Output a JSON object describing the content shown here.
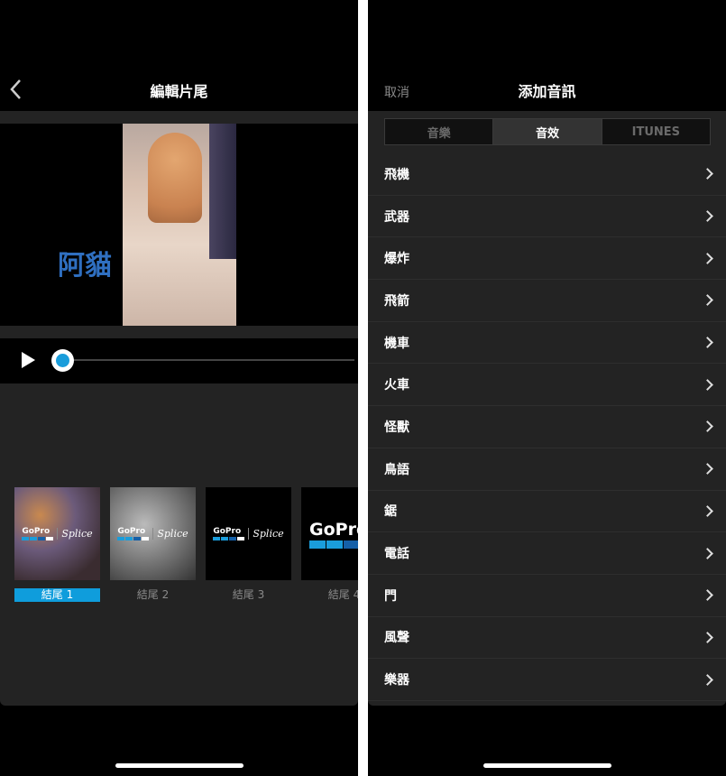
{
  "left": {
    "title": "編輯片尾",
    "video_caption": "阿貓",
    "playback_progress": 0,
    "endings": [
      {
        "label": "結尾 1",
        "selected": true,
        "style": "color-blur"
      },
      {
        "label": "結尾 2",
        "selected": false,
        "style": "gray-blur"
      },
      {
        "label": "結尾 3",
        "selected": false,
        "style": "black"
      },
      {
        "label": "結尾 4",
        "selected": false,
        "style": "black-large"
      }
    ],
    "logo": {
      "brand": "GoPro",
      "product": "Splice"
    }
  },
  "right": {
    "cancel": "取消",
    "title": "添加音訊",
    "tabs": [
      {
        "label": "音樂",
        "active": false
      },
      {
        "label": "音效",
        "active": true
      },
      {
        "label": "ITUNES",
        "active": false
      }
    ],
    "categories": [
      "飛機",
      "武器",
      "爆炸",
      "飛箭",
      "機車",
      "火車",
      "怪獸",
      "鳥語",
      "鋸",
      "電話",
      "門",
      "風聲",
      "樂器"
    ]
  },
  "colors": {
    "accent": "#0f9ddc",
    "background": "#000000",
    "panel": "#232323"
  }
}
